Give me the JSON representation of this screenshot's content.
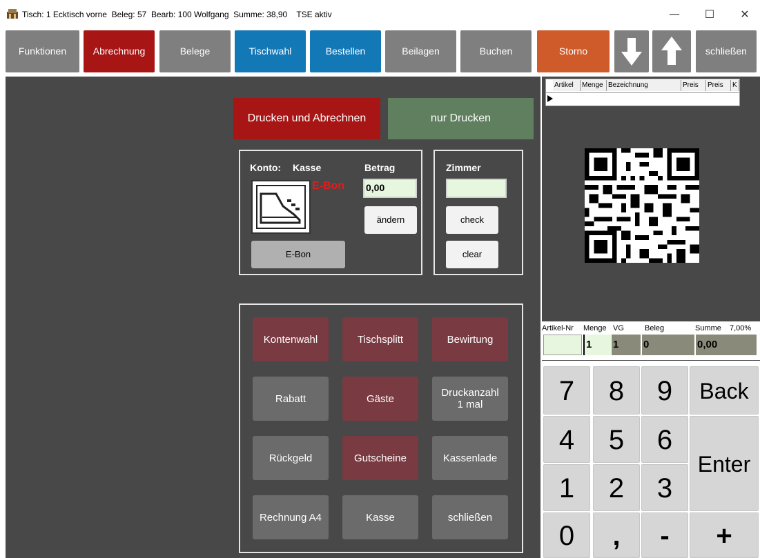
{
  "window": {
    "title": "Tisch: 1 Ecktisch vorne  Beleg: 57  Bearb: 100 Wolfgang  Summe: 38,90    TSE aktiv",
    "minimize": "—",
    "maximize": "☐",
    "close": "✕"
  },
  "toolbar": {
    "funktionen": "Funktionen",
    "abrechnung": "Abrechnung",
    "belege": "Belege",
    "tischwahl": "Tischwahl",
    "bestellen": "Bestellen",
    "beilagen": "Beilagen",
    "buchen": "Buchen",
    "storno": "Storno",
    "schliessen": "schließen"
  },
  "actions": {
    "drucken_abrechnen": "Drucken und Abrechnen",
    "nur_drucken": "nur Drucken"
  },
  "konto": {
    "konto_label": "Konto:",
    "konto_value": "Kasse",
    "betrag_label": "Betrag",
    "betrag_value": "0,00",
    "ebon_logo": "E-Bon",
    "aendern": "ändern",
    "ebon_button": "E-Bon"
  },
  "zimmer": {
    "label": "Zimmer",
    "value": "",
    "check": "check",
    "clear": "clear"
  },
  "grid": {
    "kontenwahl": "Kontenwahl",
    "tischsplitt": "Tischsplitt",
    "bewirtung": "Bewirtung",
    "rabatt": "Rabatt",
    "gaeste": "Gäste",
    "druckanzahl": "Druckanzahl",
    "druckanzahl_value": "1 mal",
    "rueckgeld": "Rückgeld",
    "gutscheine": "Gutscheine",
    "kassenlade": "Kassenlade",
    "rechnung_a4": "Rechnung A4",
    "kasse": "Kasse",
    "schliessen": "schließen"
  },
  "table": {
    "columns": [
      "Artikel",
      "Menge",
      "Bezeichnung",
      "Preis",
      "Preis",
      "K"
    ]
  },
  "info": {
    "artikel_nr_label": "Artikel-Nr",
    "menge_label": "Menge",
    "vg_label": "VG",
    "beleg_label": "Beleg",
    "summe_label": "Summe",
    "tax_label": "7,00%",
    "artikel_nr": "",
    "menge": "1",
    "vg": "1",
    "beleg": "0",
    "summe": "0,00"
  },
  "keypad": {
    "k7": "7",
    "k8": "8",
    "k9": "9",
    "back": "Back",
    "k4": "4",
    "k5": "5",
    "k6": "6",
    "enter": "Enter",
    "k1": "1",
    "k2": "2",
    "k3": "3",
    "k0": "0",
    "comma": ",",
    "minus": "-",
    "plus": "+"
  },
  "colors": {
    "accent_red": "#a81515",
    "accent_blue": "#1378b6",
    "storno_orange": "#cf5a2a",
    "green_button": "#5f7f5f",
    "maroon_button": "#7a3a42",
    "background": "#484848"
  }
}
